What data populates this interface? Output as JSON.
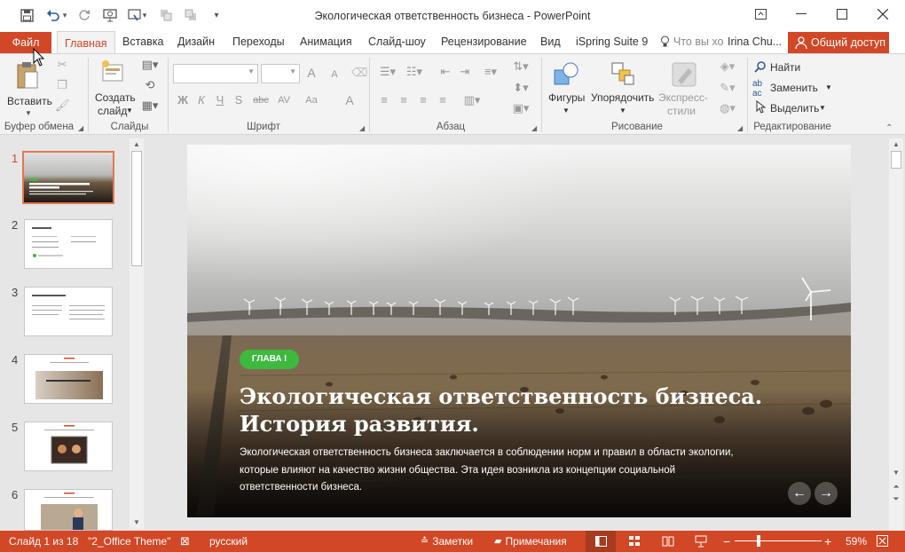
{
  "window": {
    "title": "Экологическая ответственность бизнеса - PowerPoint"
  },
  "ribbon_tabs": {
    "file": "Файл",
    "home": "Главная",
    "insert": "Вставка",
    "design": "Дизайн",
    "transitions": "Переходы",
    "animation": "Анимация",
    "slideshow": "Слайд-шоу",
    "review": "Рецензирование",
    "view": "Вид",
    "ispring": "iSpring Suite 9",
    "tellme": "Что вы хо",
    "user": "Irina Chu...",
    "share": "Общий доступ"
  },
  "ribbon": {
    "paste": "Вставить",
    "new_slide_1": "Создать",
    "new_slide_2": "слайд",
    "shapes": "Фигуры",
    "arrange": "Упорядочить",
    "quick_styles_1": "Экспресс-",
    "quick_styles_2": "стили",
    "find": "Найти",
    "replace": "Заменить",
    "select": "Выделить",
    "groups": {
      "clipboard": "Буфер обмена",
      "slides": "Слайды",
      "font": "Шрифт",
      "paragraph": "Абзац",
      "drawing": "Рисование",
      "editing": "Редактирование"
    },
    "font_buttons": {
      "bold": "Ж",
      "italic": "К",
      "underline": "Ч",
      "shadow": "S",
      "strike": "abc",
      "spacing": "AV",
      "case": "Aa",
      "color": "A",
      "grow": "A",
      "shrink": "A"
    }
  },
  "slides_panel": {
    "numbers": [
      "1",
      "2",
      "3",
      "4",
      "5",
      "6"
    ]
  },
  "slide": {
    "chapter_label": "ГЛАВА I",
    "title_line1": "Экологическая ответственность бизнеса.",
    "title_line2": "История развития.",
    "body_line1": "Экологическая ответственность бизнеса заключается в соблюдении норм и правил в области экологии,",
    "body_line2": "которые влияют на качество жизни общества. Эта идея возникла из концепции социальной",
    "body_line3": "ответственности бизнеса."
  },
  "statusbar": {
    "slide_info": "Слайд 1 из 18",
    "theme": "\"2_Office Theme\"",
    "language": "русский",
    "notes": "Заметки",
    "comments": "Примечания",
    "zoom": "59%"
  },
  "colors": {
    "accent": "#d24726",
    "chapter_badge": "#3dba3d"
  }
}
